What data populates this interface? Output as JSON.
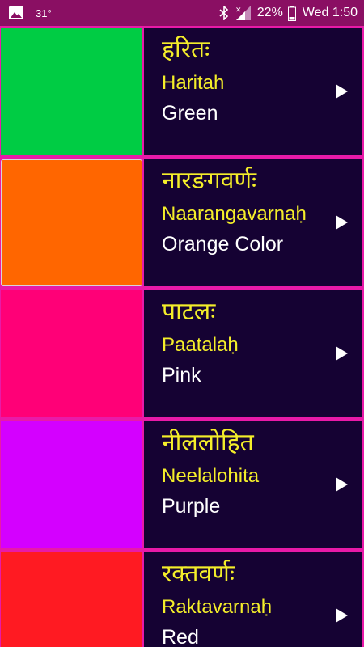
{
  "status_bar": {
    "temperature": "31°",
    "battery_percent": "22%",
    "time": "Wed 1:50",
    "icons": [
      "gallery-icon",
      "bluetooth-icon",
      "signal-icon",
      "battery-icon"
    ]
  },
  "colors": {
    "background": "#e81aa8",
    "status_bar": "#8a0f63",
    "panel": "#150233",
    "title_text": "#f4ee2a",
    "english_text": "#ffffff"
  },
  "items": [
    {
      "sanskrit": "हरितः",
      "transliteration": "Haritah",
      "english": "Green",
      "swatch": "#00cc44"
    },
    {
      "sanskrit": "नारङगवर्णः",
      "transliteration": "Naarangavarnaḥ",
      "english": "Orange Color",
      "swatch": "#ff6600"
    },
    {
      "sanskrit": "पाटलः",
      "transliteration": "Paatalaḥ",
      "english": "Pink",
      "swatch": "#ff0077"
    },
    {
      "sanskrit": "नीललोहित",
      "transliteration": "Neelalohita",
      "english": "Purple",
      "swatch": "#d400ff"
    },
    {
      "sanskrit": "रक्तवर्णः",
      "transliteration": "Raktavarnaḥ",
      "english": "Red",
      "swatch": "#ff1a22"
    }
  ]
}
